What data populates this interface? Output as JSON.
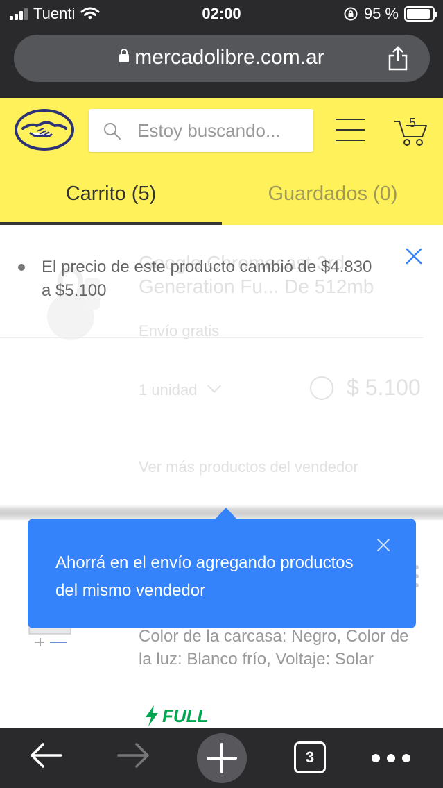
{
  "status_bar": {
    "carrier": "Tuenti",
    "time": "02:00",
    "battery": "95 %"
  },
  "browser": {
    "url": "mercadolibre.com.ar",
    "open_tabs": "3"
  },
  "header": {
    "search_placeholder": "Estoy buscando...",
    "cart_count": "5",
    "brand_color": "#fff159"
  },
  "tabs": [
    {
      "label": "Carrito (5)",
      "active": true
    },
    {
      "label": "Guardados (0)",
      "active": false
    }
  ],
  "notice": {
    "message": "El precio de este producto cambió de $4.830 a $5.100"
  },
  "cart_item": {
    "title": "Google Chromecast 3rd Generation Fu... De 512mb",
    "shipping": "Envío gratis",
    "quantity": "1 unidad",
    "price": "$ 5.100",
    "more_from_seller": "Ver más productos del vendedor"
  },
  "cart_item_2": {
    "description": "Color de la carcasa: Negro, Color de la luz: Blanco frío, Voltaje: Solar",
    "badge": "FULL",
    "badge_color": "#00a650"
  },
  "tooltip": {
    "message": "Ahorrá en el envío agregando productos del mismo vendedor",
    "color": "#3483fa"
  }
}
